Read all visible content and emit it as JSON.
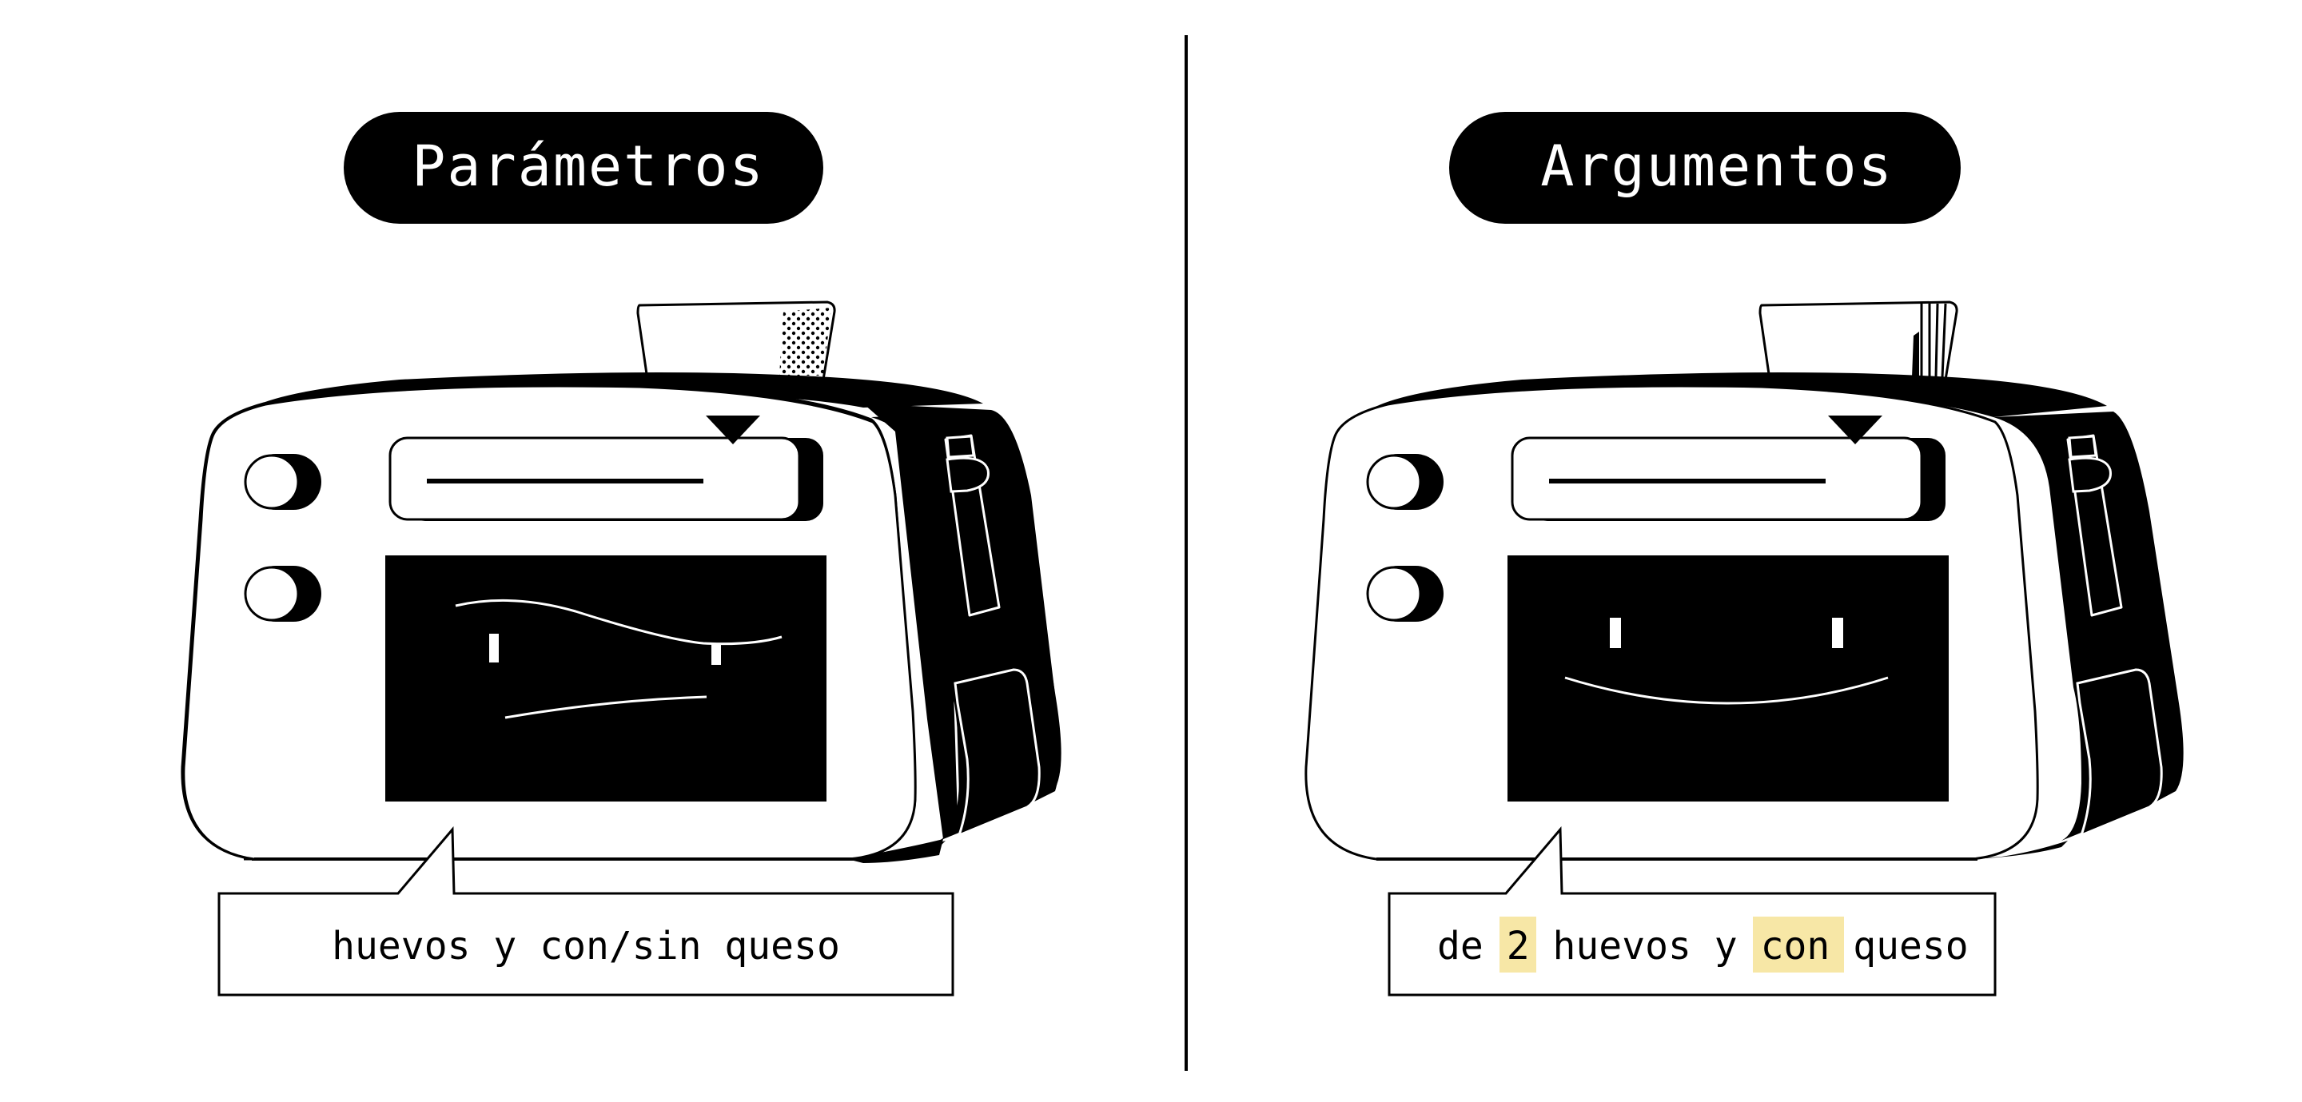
{
  "left_panel": {
    "title": "Parámetros",
    "speech_text": "huevos y con/sin queso",
    "screen_expression": "confused-face"
  },
  "right_panel": {
    "title": "Argumentos",
    "speech_parts": [
      {
        "text": "de ",
        "highlight": false
      },
      {
        "text": "2",
        "highlight": true
      },
      {
        "text": " huevos y ",
        "highlight": false
      },
      {
        "text": "con",
        "highlight": true
      },
      {
        "text": " queso",
        "highlight": false
      }
    ],
    "screen_expression": "happy-face"
  },
  "colors": {
    "ink": "#000000",
    "paper": "#ffffff",
    "highlight": "#f7e7a6"
  },
  "icons": {
    "device": "toaster-oven-robot-icon",
    "divider": "vertical-divider"
  }
}
